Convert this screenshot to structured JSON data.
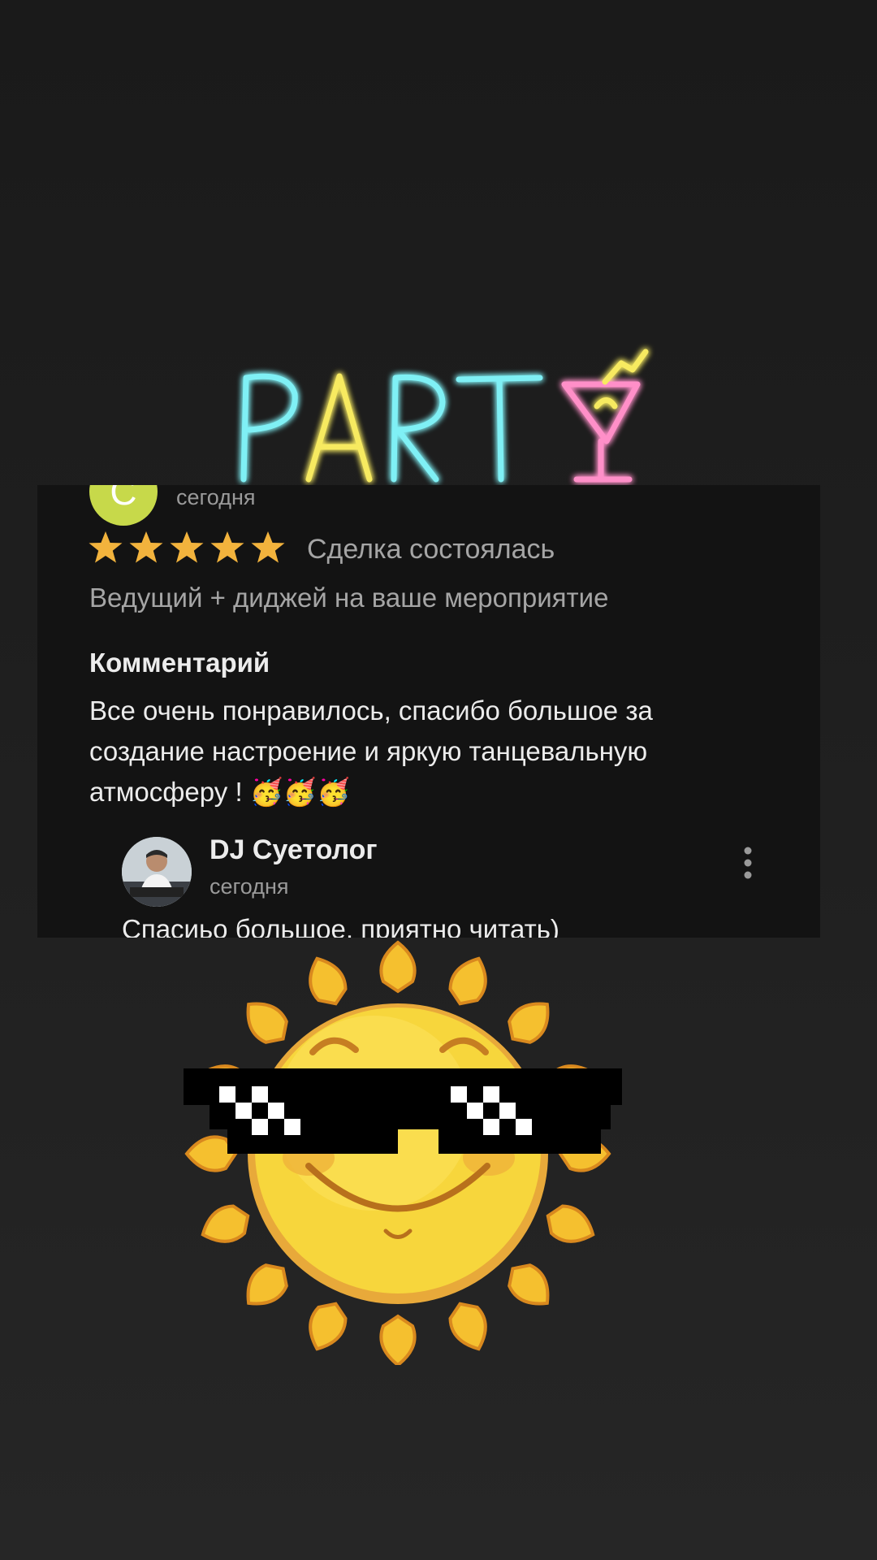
{
  "sticker": {
    "party_text": "PARTY",
    "sun_icon": "sunglasses-sun-sticker"
  },
  "review": {
    "user_initial": "С",
    "user_avatar_color": "#c7d94a",
    "date": "сегодня",
    "rating": 5,
    "rating_max": 5,
    "star_color": "#f2b33d",
    "deal_status": "Сделка состоялась",
    "service": "Ведущий + диджей на ваше мероприятие",
    "comment_title": "Комментарий",
    "comment_text": "Все очень понравилось, спасибо большое за создание настроение и яркую танцевальную атмосферу ! 🥳🥳🥳"
  },
  "reply": {
    "author": "DJ Суетолог",
    "date": "сегодня",
    "text": "Спасиьо большое, приятно читать)",
    "menu_icon": "more-vertical-icon"
  }
}
